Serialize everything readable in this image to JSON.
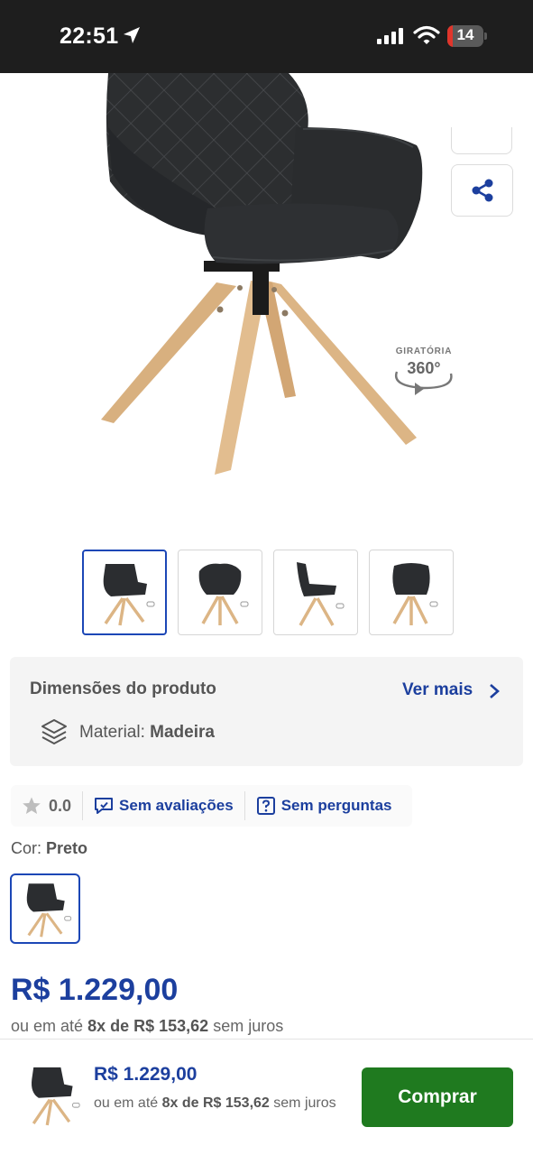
{
  "status_bar": {
    "time": "22:51",
    "battery": "14",
    "battery_level": 0.14
  },
  "hero": {
    "badge_label": "GIRATÓRIA",
    "badge_value": "360°"
  },
  "thumbnails": {
    "count": 4,
    "active_index": 0
  },
  "dimensions": {
    "title": "Dimensões do produto",
    "more_label": "Ver mais",
    "material_label": "Material:",
    "material_value": "Madeira"
  },
  "rating": {
    "score": "0.0",
    "reviews_label": "Sem avaliações",
    "questions_label": "Sem perguntas"
  },
  "color": {
    "label": "Cor:",
    "value": "Preto"
  },
  "price": {
    "main": "R$ 1.229,00",
    "installments_prefix": "ou em até",
    "installments_bold": "8x de R$ 153,62",
    "installments_suffix": "sem juros"
  },
  "bottom_bar": {
    "price": "R$ 1.229,00",
    "installments_prefix": "ou em até",
    "installments_bold": "8x de R$ 153,62",
    "installments_suffix": "sem juros",
    "buy_label": "Comprar"
  },
  "colors": {
    "primary_blue": "#1c3f9e",
    "buy_green": "#1f7a1f",
    "wood": "#e0b98a",
    "upholstery": "#2a2c2e"
  }
}
